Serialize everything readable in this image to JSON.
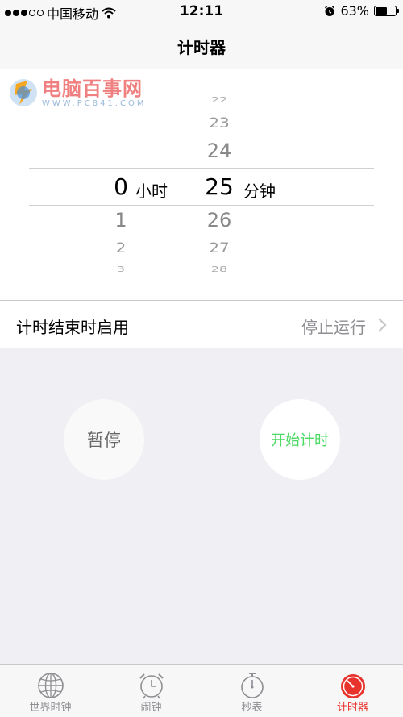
{
  "status": {
    "carrier": "中国移动",
    "time": "12:11",
    "battery_percent": "63%",
    "battery_level": 0.63,
    "signal_filled": 3,
    "signal_total": 5
  },
  "nav": {
    "title": "计时器"
  },
  "watermark": {
    "main": "电脑百事网",
    "sub": "WWW.PC841.COM"
  },
  "picker": {
    "hours": {
      "above": [],
      "selected": "0",
      "below": [
        "1",
        "2",
        "3"
      ],
      "unit": "小时"
    },
    "minutes": {
      "above": [
        "22",
        "23",
        "24"
      ],
      "selected": "25",
      "below": [
        "26",
        "27",
        "28"
      ],
      "unit": "分钟"
    }
  },
  "on_finish": {
    "label": "计时结束时启用",
    "value": "停止运行"
  },
  "buttons": {
    "pause": "暂停",
    "start": "开始计时"
  },
  "tabs": [
    {
      "label": "世界时钟",
      "icon": "globe-icon",
      "active": false
    },
    {
      "label": "闹钟",
      "icon": "alarm-clock-icon",
      "active": false
    },
    {
      "label": "秒表",
      "icon": "stopwatch-icon",
      "active": false
    },
    {
      "label": "计时器",
      "icon": "timer-icon",
      "active": true
    }
  ],
  "colors": {
    "accent": "#e8322c",
    "start_green": "#4cd964",
    "secondary_gray": "#8e8e93"
  }
}
